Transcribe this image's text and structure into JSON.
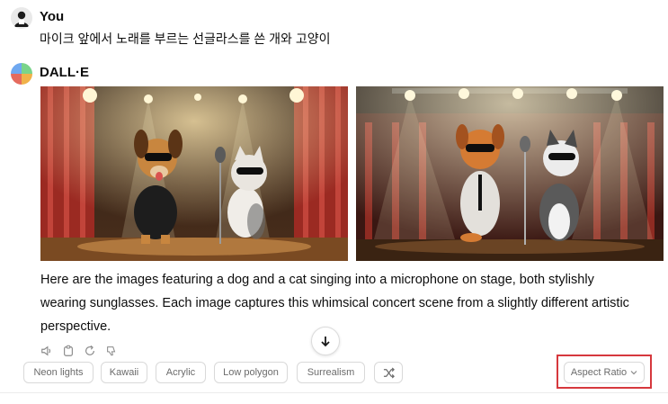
{
  "user_message": {
    "author": "You",
    "text": "마이크 앞에서 노래를 부르는 선글라스를 쓴 개와 고양이"
  },
  "assistant_message": {
    "author": "DALL·E",
    "reply_lines": [
      "Here are the images featuring a dog and a cat singing into a microphone on stage, both stylishly",
      "wearing sunglasses. Each image captures this whimsical concert scene from a slightly different artistic",
      "perspective."
    ]
  },
  "images": [
    {
      "icon": "generated-image-dog-cat-stage-1"
    },
    {
      "icon": "generated-image-dog-cat-stage-2"
    }
  ],
  "action_icons": [
    "speaker-icon",
    "copy-icon",
    "regenerate-icon",
    "thumbs-down-icon"
  ],
  "style_chips": [
    "Neon lights",
    "Kawaii",
    "Acrylic",
    "Low polygon",
    "Surrealism"
  ],
  "shuffle_icon": "shuffle-icon",
  "aspect_ratio": {
    "label": "Aspect Ratio",
    "icon": "chevron-down-icon",
    "highlight_color": "#d6383d"
  },
  "scroll_down_icon": "arrow-down-icon"
}
